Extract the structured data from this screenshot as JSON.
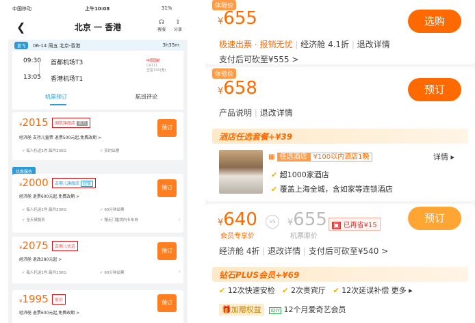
{
  "left": {
    "status": {
      "carrier": "中国移动",
      "time": "上午10:08",
      "battery": "31%"
    },
    "nav": {
      "back": "❮",
      "title": "北京 一 香港",
      "service_label": "客服",
      "share_label": "分享",
      "service_icon": "☊",
      "share_icon": "⇪"
    },
    "flight": {
      "tag": "直飞",
      "info": "06-14 周五 北京-香港",
      "duration": "3h35m"
    },
    "times": [
      {
        "time": "09:30",
        "airport": "首都机场T3"
      },
      {
        "time": "13:05",
        "airport": "香港机场T1"
      }
    ],
    "airline": {
      "name": "中国国航",
      "code": "CA111",
      "aircraft": "空客330(宽)"
    },
    "tabs": [
      "机票预订",
      "航班评论"
    ],
    "youhui_label": "优惠服务",
    "cards": [
      {
        "price": "2015",
        "currency": "¥",
        "badge": "国航旗舰店",
        "badge_tag": "官方",
        "sub": "经济舱   支持儿童票   退票500元起,免费改期 >",
        "checks": [
          "每人托运1件,每件23KG",
          "实时出票"
        ],
        "button": "预订"
      },
      {
        "price": "2000",
        "currency": "¥",
        "badge": "去哪儿旗舰店",
        "badge_tag": "超值",
        "sub": "经济舱   退票600元起,免费改期 >",
        "checks": [
          "每人托运1件,每件23KG",
          "60分钟出票",
          "全天候服务",
          "赠无门槛境内专车券"
        ],
        "button": "预订"
      },
      {
        "price": "2075",
        "currency": "¥",
        "badge": "去哪儿优选",
        "sub": "经济舱   退改280元起 >",
        "checks": [
          "每人托运1件,每件23KG",
          "60分钟出票"
        ],
        "button": "预订"
      },
      {
        "price": "1995",
        "currency": "¥",
        "badge": "低价",
        "sub": "经济舱   退票600元起,免费改期 >",
        "checks": [],
        "button": "预订"
      }
    ]
  },
  "right": {
    "block1": {
      "tag": "体验价",
      "price": "655",
      "currency": "¥",
      "button": "选购",
      "line1": [
        "极速出票 · 报销无忧",
        "经济舱 4.1折",
        "退改详情"
      ],
      "line2": "支付后可砍至¥555 >"
    },
    "block2": {
      "tag": "体验价",
      "price": "658",
      "currency": "¥",
      "button": "预订",
      "line1": [
        "产品说明",
        "退改详情"
      ]
    },
    "hotel": {
      "title": "酒店任选套餐",
      "plus": "+¥39",
      "tag": "任选酒店",
      "tag_desc": "¥100以内酒店1晚",
      "detail": "详情 ▸",
      "item1": "超1000家酒店",
      "item2": "覆盖上海全城，含如家等连锁酒店"
    },
    "block3": {
      "price": "640",
      "currency": "¥",
      "member_label": "会员专享价",
      "vs": "VS",
      "orig_price": "655",
      "orig_label": "机票原价",
      "saved": "已再省¥15",
      "button": "预订",
      "line1": [
        "经济舱 4折",
        "退改详情",
        "支付后可砍至¥540 >"
      ]
    },
    "plus": {
      "title": "钻石PLUS会员",
      "plus": "+¥69",
      "benefits": [
        "12次快速安检",
        "2次贵宾厅",
        "12次延误补偿"
      ],
      "more": "更多 ▸",
      "gift": "加赠权益",
      "iqiyi": "12个月爱奇艺会员"
    },
    "colors": {
      "accent": "#ff6a00",
      "blue": "#2e9bd6",
      "check": "#f0b000"
    }
  }
}
